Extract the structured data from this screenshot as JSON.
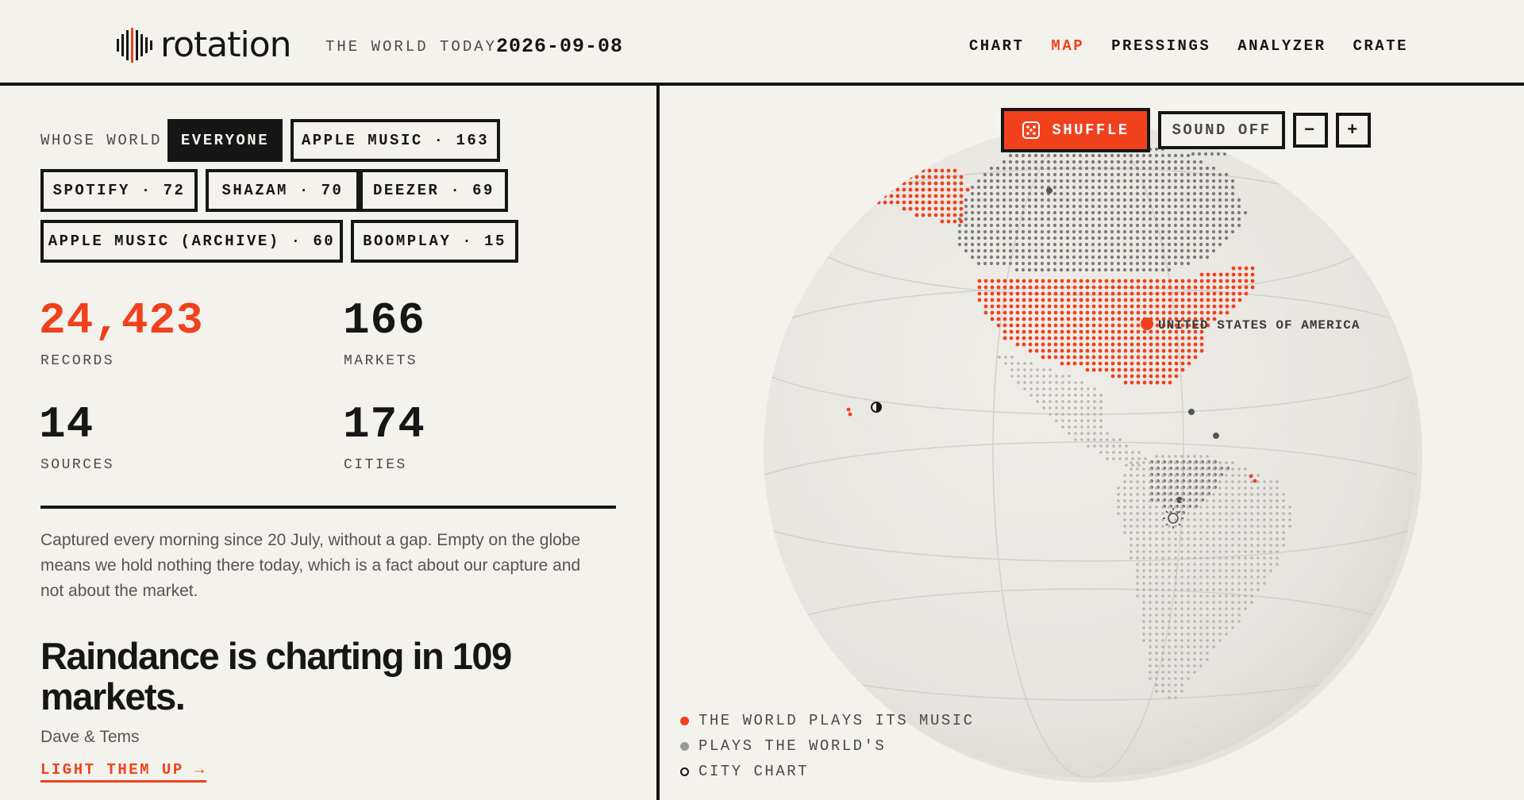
{
  "header": {
    "brand": "rotation",
    "tagline": "THE WORLD TODAY",
    "date": "2026-09-08",
    "nav": [
      {
        "label": "CHART",
        "active": false
      },
      {
        "label": "MAP",
        "active": true
      },
      {
        "label": "PRESSINGS",
        "active": false
      },
      {
        "label": "ANALYZER",
        "active": false
      },
      {
        "label": "CRATE",
        "active": false
      }
    ]
  },
  "filters": {
    "label": "WHOSE WORLD",
    "options": [
      {
        "label": "EVERYONE",
        "selected": true
      },
      {
        "label": "APPLE MUSIC · 163",
        "selected": false
      },
      {
        "label": "SPOTIFY · 72",
        "selected": false
      },
      {
        "label": "SHAZAM · 70",
        "selected": false
      },
      {
        "label": "DEEZER · 69",
        "selected": false
      },
      {
        "label": "APPLE MUSIC (ARCHIVE) · 60",
        "selected": false
      },
      {
        "label": "BOOMPLAY · 15",
        "selected": false
      }
    ]
  },
  "stats": {
    "records": {
      "value": "24,423",
      "label": "RECORDS"
    },
    "markets": {
      "value": "166",
      "label": "MARKETS"
    },
    "sources": {
      "value": "14",
      "label": "SOURCES"
    },
    "cities": {
      "value": "174",
      "label": "CITIES"
    }
  },
  "blurb": "Captured every morning since 20 July, without a gap. Empty on the globe means we hold nothing there today, which is a fact about our capture and not about the market.",
  "feature": {
    "headline": "Raindance is charting in 109 markets.",
    "artist": "Dave & Tems",
    "cta": "LIGHT THEM UP →"
  },
  "map": {
    "controls": {
      "shuffle": "SHUFFLE",
      "sound": "SOUND OFF",
      "zoom_out": "−",
      "zoom_in": "+"
    },
    "focus_label": "UNITED STATES OF AMERICA",
    "legend": [
      {
        "label": "THE WORLD PLAYS ITS MUSIC",
        "color": "#f0401c",
        "style": "filled"
      },
      {
        "label": "PLAYS THE WORLD'S",
        "color": "#999999",
        "style": "filled"
      },
      {
        "label": "CITY CHART",
        "color": "#161616",
        "style": "ring"
      }
    ],
    "colors": {
      "accent": "#f0401c",
      "neutral_dot": "#7a7a7a",
      "faint_dot": "#b8b6b0",
      "globe": "#ebe9e4"
    }
  }
}
